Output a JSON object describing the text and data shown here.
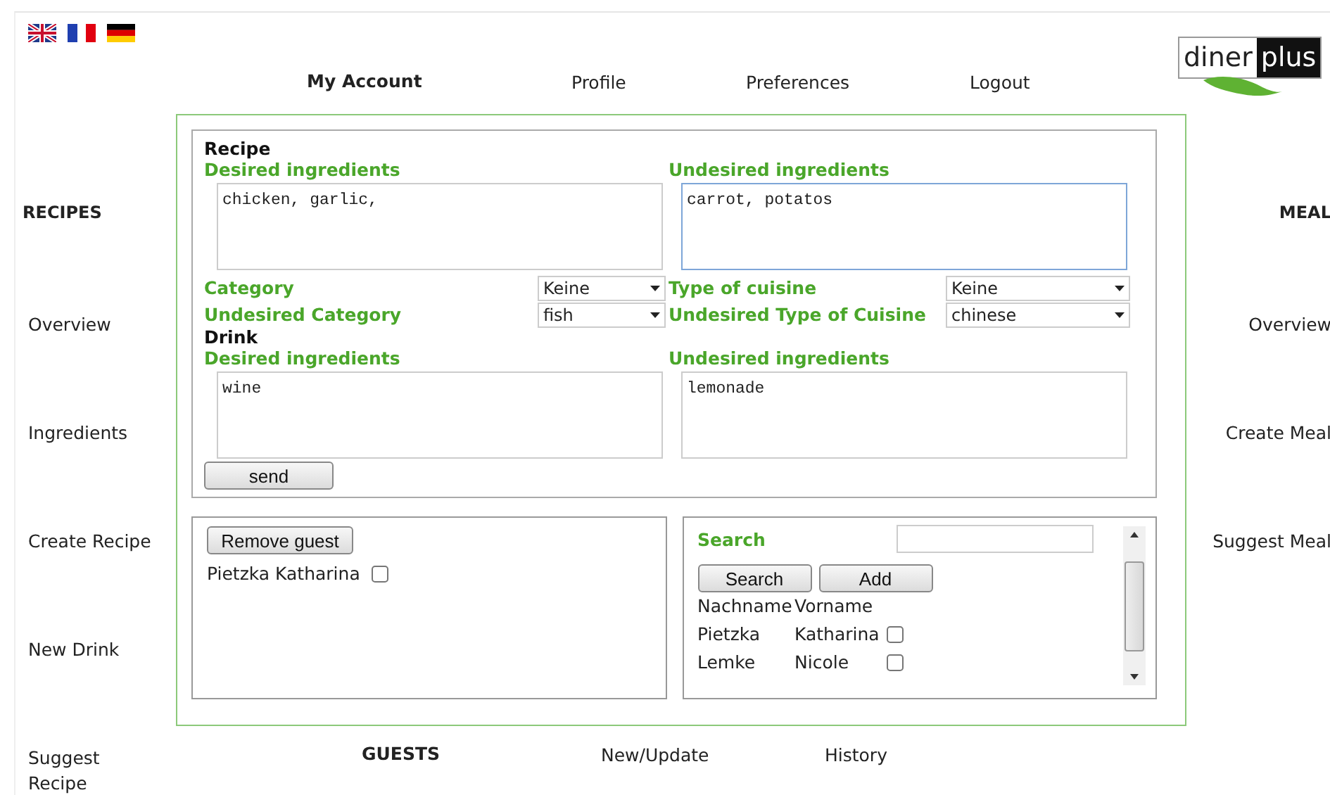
{
  "header": {
    "heading": "My Account",
    "links": [
      "Profile",
      "Preferences",
      "Logout"
    ]
  },
  "logo": {
    "part_1": "diner",
    "part_2": "plus"
  },
  "left_sidebar": {
    "heading": "RECIPES",
    "links": [
      "Overview",
      "Ingredients",
      "Create Recipe",
      "New Drink",
      "Suggest Recipe"
    ]
  },
  "right_sidebar": {
    "heading": "MEAL",
    "links": [
      "Overview",
      "Create Meal",
      "Suggest Meal"
    ]
  },
  "recipe_form": {
    "title": "Recipe",
    "desired": {
      "label": "Desired ingredients",
      "value": "chicken, garlic,"
    },
    "undesired": {
      "label": "Undesired ingredients",
      "value": "carrot, potatos",
      "focused": true
    },
    "selects": [
      {
        "label": "Category",
        "value": "Keine"
      },
      {
        "label": "Type of cuisine",
        "value": "Keine"
      },
      {
        "label": "Undesired Category",
        "value": "fish"
      },
      {
        "label": "Undesired Type of Cuisine",
        "value": "chinese"
      }
    ],
    "drink_title": "Drink",
    "drink_desired": {
      "label": "Desired ingredients",
      "value": "wine"
    },
    "drink_undesired": {
      "label": "Undesired ingredients",
      "value": "lemonade",
      "focused": false
    },
    "submit": "send"
  },
  "guest_list": {
    "remove_button": "Remove guest",
    "guests": [
      {
        "name": "Pietzka Katharina",
        "checked": false
      }
    ]
  },
  "guest_search": {
    "label": "Search",
    "buttons": [
      "Search",
      "Add"
    ],
    "columns": [
      "Nachname",
      "Vorname"
    ],
    "rows": [
      {
        "last_name": "Pietzka",
        "first_name": "Katharina",
        "checked": false
      },
      {
        "last_name": "Lemke",
        "first_name": "Nicole",
        "checked": false
      }
    ]
  },
  "footer_nav": {
    "heading": "GUESTS",
    "links": [
      "New/Update",
      "History"
    ]
  }
}
